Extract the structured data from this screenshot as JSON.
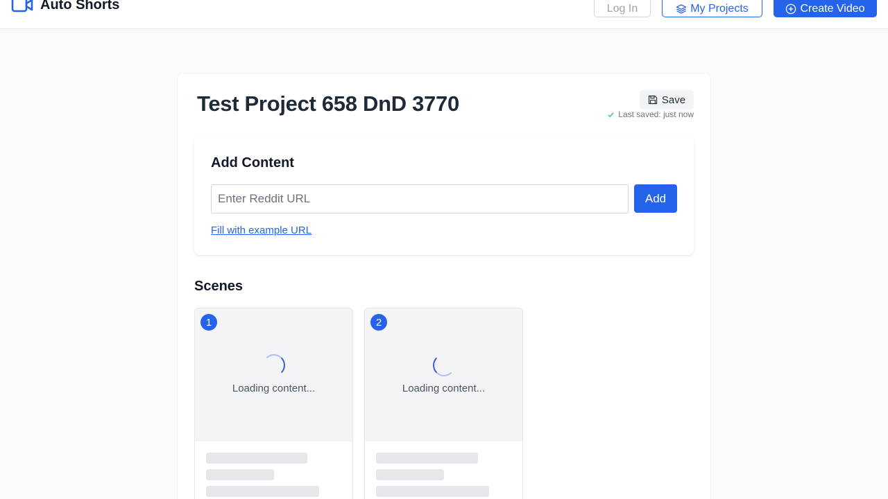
{
  "nav": {
    "brand": "Auto Shorts",
    "login_label": "Log In",
    "projects_label": "My Projects",
    "create_label": "Create Video"
  },
  "project": {
    "title": "Test Project 658 DnD 3770",
    "save_label": "Save",
    "saved_status": "Last saved: just now"
  },
  "add_content": {
    "title": "Add Content",
    "url_placeholder": "Enter Reddit URL",
    "url_value": "",
    "add_label": "Add",
    "example_link": "Fill with example URL"
  },
  "scenes": {
    "title": "Scenes",
    "items": [
      {
        "number": "1",
        "status": "Loading content..."
      },
      {
        "number": "2",
        "status": "Loading content..."
      }
    ]
  },
  "colors": {
    "accent": "#2563eb",
    "text": "#1f2937",
    "success": "#22c55e"
  }
}
